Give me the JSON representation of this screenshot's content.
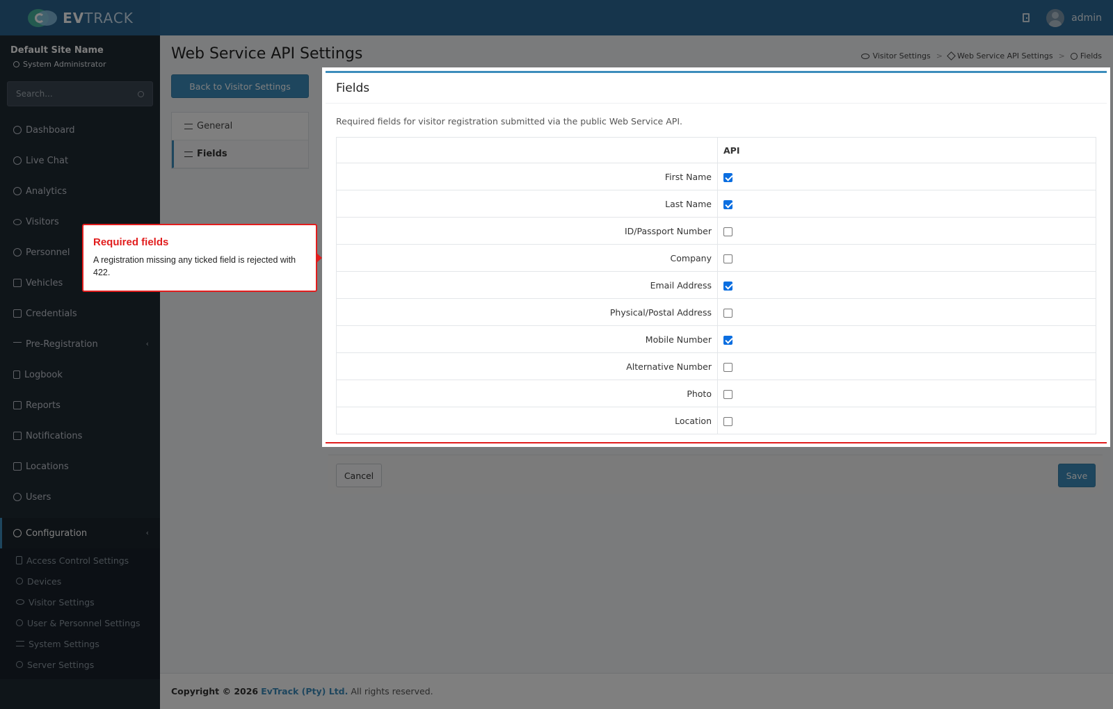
{
  "app": {
    "logo_text_bold": "EV",
    "logo_text_rest": "TRACK",
    "user": "admin"
  },
  "sidebar": {
    "site_name": "Default Site Name",
    "role": "System Administrator",
    "search_placeholder": "Search...",
    "items": [
      {
        "label": "Dashboard",
        "icon": "dashboard-icon"
      },
      {
        "label": "Live Chat",
        "icon": "headset-icon"
      },
      {
        "label": "Analytics",
        "icon": "target-icon"
      },
      {
        "label": "Visitors",
        "icon": "eye-icon"
      },
      {
        "label": "Personnel",
        "icon": "users-icon"
      },
      {
        "label": "Vehicles",
        "icon": "car-icon"
      },
      {
        "label": "Credentials",
        "icon": "id-card-icon"
      },
      {
        "label": "Pre-Registration",
        "icon": "exchange-icon"
      },
      {
        "label": "Logbook",
        "icon": "book-icon"
      },
      {
        "label": "Reports",
        "icon": "chart-icon"
      },
      {
        "label": "Notifications",
        "icon": "bell-icon"
      },
      {
        "label": "Locations",
        "icon": "map-icon"
      },
      {
        "label": "Users",
        "icon": "user-cog-icon"
      }
    ],
    "configuration": "Configuration",
    "sub_items": [
      {
        "label": "Access Control Settings"
      },
      {
        "label": "Devices"
      },
      {
        "label": "Visitor Settings"
      },
      {
        "label": "User & Personnel Settings"
      },
      {
        "label": "System Settings"
      },
      {
        "label": "Server Settings"
      }
    ]
  },
  "page": {
    "title": "Web Service API Settings",
    "breadcrumb": [
      "Visitor Settings",
      "Web Service API Settings",
      "Fields"
    ],
    "back_button": "Back to Visitor Settings",
    "tabs": [
      "General",
      "Fields"
    ]
  },
  "card": {
    "title": "Fields",
    "description": "Required fields for visitor registration submitted via the public Web Service API.",
    "column_header": "API",
    "rows": [
      {
        "label": "First Name",
        "checked": true
      },
      {
        "label": "Last Name",
        "checked": true
      },
      {
        "label": "ID/Passport Number",
        "checked": false
      },
      {
        "label": "Company",
        "checked": false
      },
      {
        "label": "Email Address",
        "checked": true
      },
      {
        "label": "Physical/Postal Address",
        "checked": false
      },
      {
        "label": "Mobile Number",
        "checked": true
      },
      {
        "label": "Alternative Number",
        "checked": false
      },
      {
        "label": "Photo",
        "checked": false
      },
      {
        "label": "Location",
        "checked": false
      }
    ]
  },
  "actions": {
    "cancel": "Cancel",
    "save": "Save"
  },
  "footer": {
    "copyright": "Copyright © 2026",
    "org": "EvTrack (Pty) Ltd.",
    "rights": "All rights reserved."
  },
  "callout": {
    "title": "Required fields",
    "text": "A registration missing any ticked field is rejected with 422."
  },
  "colors": {
    "primary": "#3c8dbc",
    "sidebar": "#1f2a33",
    "highlight": "#e11d1d",
    "check": "#0b6ee0"
  }
}
